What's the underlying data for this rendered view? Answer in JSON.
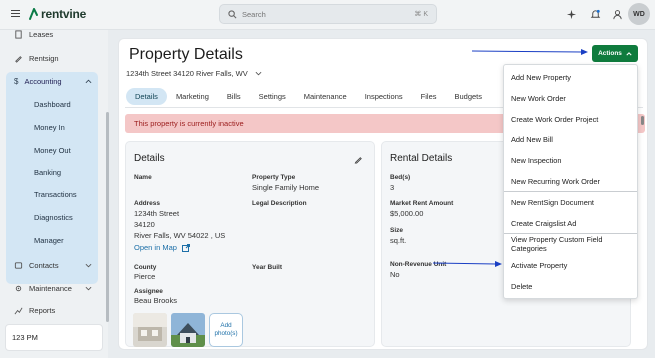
{
  "app": {
    "logo_text": "rentvine",
    "avatar_initials": "WD"
  },
  "search": {
    "placeholder": "Search",
    "shortcut": "⌘ K"
  },
  "sidebar": {
    "items": [
      {
        "label": "Leases"
      },
      {
        "label": "Rentsign"
      },
      {
        "label": "Accounting"
      },
      {
        "label": "Contacts"
      },
      {
        "label": "Maintenance"
      },
      {
        "label": "Reports"
      }
    ],
    "accounting_sub": [
      "Dashboard",
      "Money In",
      "Money Out",
      "Banking",
      "Transactions",
      "Diagnostics",
      "Manager"
    ],
    "unit_label": "123 PM"
  },
  "page": {
    "title": "Property Details",
    "address": "1234th Street 34120 River Falls, WV",
    "tabs": [
      "Details",
      "Marketing",
      "Bills",
      "Settings",
      "Maintenance",
      "Inspections",
      "Files",
      "Budgets"
    ],
    "banner": "This property is currently inactive"
  },
  "details": {
    "title": "Details",
    "name_label": "Name",
    "name_value": "",
    "property_type_label": "Property Type",
    "property_type_value": "Single Family Home",
    "address_label": "Address",
    "address_lines": [
      "1234th Street",
      "34120",
      "River Falls, WV 54022 , US"
    ],
    "map_link": "Open in Map",
    "legal_label": "Legal Description",
    "county_label": "County",
    "county_value": "Pierce",
    "year_built_label": "Year Built",
    "assignee_label": "Assignee",
    "assignee_value": "Beau Brooks",
    "add_photo": "Add photo(s)"
  },
  "rental": {
    "title": "Rental Details",
    "beds_label": "Bed(s)",
    "beds_value": "3",
    "market_rent_label": "Market Rent Amount",
    "market_rent_value": "$5,000.00",
    "size_label": "Size",
    "size_value": "sq.ft.",
    "nonrev_label": "Non-Revenue Unit",
    "nonrev_value": "No"
  },
  "actions": {
    "button_label": "Actions",
    "menu": [
      "Add New Property",
      "New Work Order",
      "Create Work Order Project",
      "Add New Bill",
      "New Inspection",
      "New Recurring Work Order",
      "New RentSign Document",
      "Create Craigslist Ad",
      "View Property Custom Field Categories",
      "Activate Property",
      "Delete"
    ]
  },
  "colors": {
    "brand": "#0f7b3d",
    "accent_blue": "#d3e6f4",
    "link": "#1c6fa8",
    "banner_bg": "#f4c7c7",
    "banner_text": "#9b1c1c",
    "arrow": "#1a3fc4"
  }
}
